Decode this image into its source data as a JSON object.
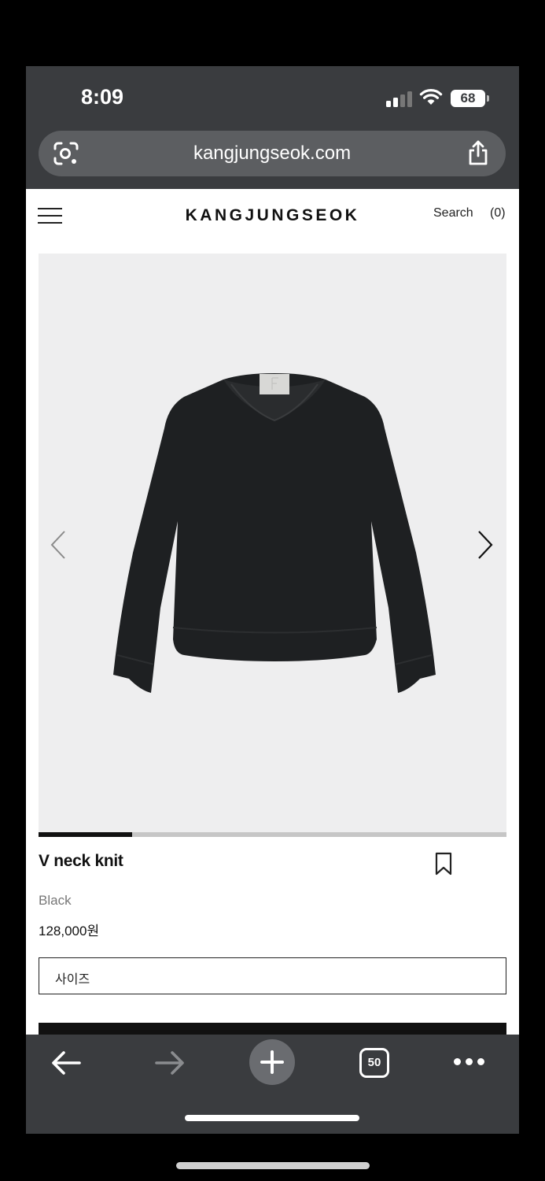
{
  "status_bar": {
    "time": "8:09",
    "battery": "68"
  },
  "browser": {
    "url": "kangjungseok.com",
    "open_tabs": "50"
  },
  "site_header": {
    "brand": "KANGJUNGSEOK",
    "search_label": "Search",
    "cart_label": "(0)"
  },
  "gallery": {
    "progress": 0.2
  },
  "product": {
    "name": "V neck knit",
    "color": "Black",
    "price": "128,000원",
    "size_select_label": "사이즈"
  },
  "colors": {
    "browser_chrome": "#3a3c3f",
    "image_background": "#eeeeef",
    "accent": "#111111"
  }
}
